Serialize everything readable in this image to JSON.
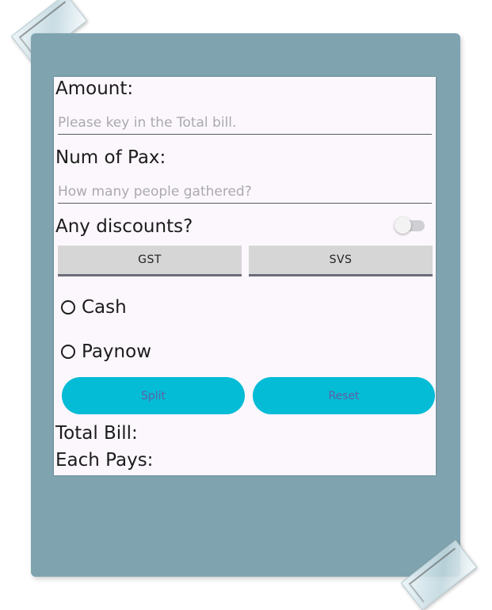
{
  "form": {
    "amount_label": "Amount:",
    "amount_placeholder": "Please key in the Total bill.",
    "amount_value": "",
    "pax_label": "Num of Pax:",
    "pax_placeholder": "How many people gathered?",
    "pax_value": "",
    "discount_label": "Any discounts?",
    "discount_toggle_on": false
  },
  "tabs": [
    {
      "label": "GST"
    },
    {
      "label": "SVS"
    }
  ],
  "payment": {
    "options": [
      {
        "label": "Cash",
        "selected": false
      },
      {
        "label": "Paynow",
        "selected": false
      }
    ]
  },
  "actions": {
    "split_label": "Split",
    "reset_label": "Reset"
  },
  "results": {
    "total_label": "Total Bill:",
    "each_label": "Each Pays:"
  },
  "colors": {
    "frame": "#7fa4b0",
    "screen_bg": "#fcf7fc",
    "accent_button": "#05bcd6",
    "button_text": "#5f5fa6"
  }
}
